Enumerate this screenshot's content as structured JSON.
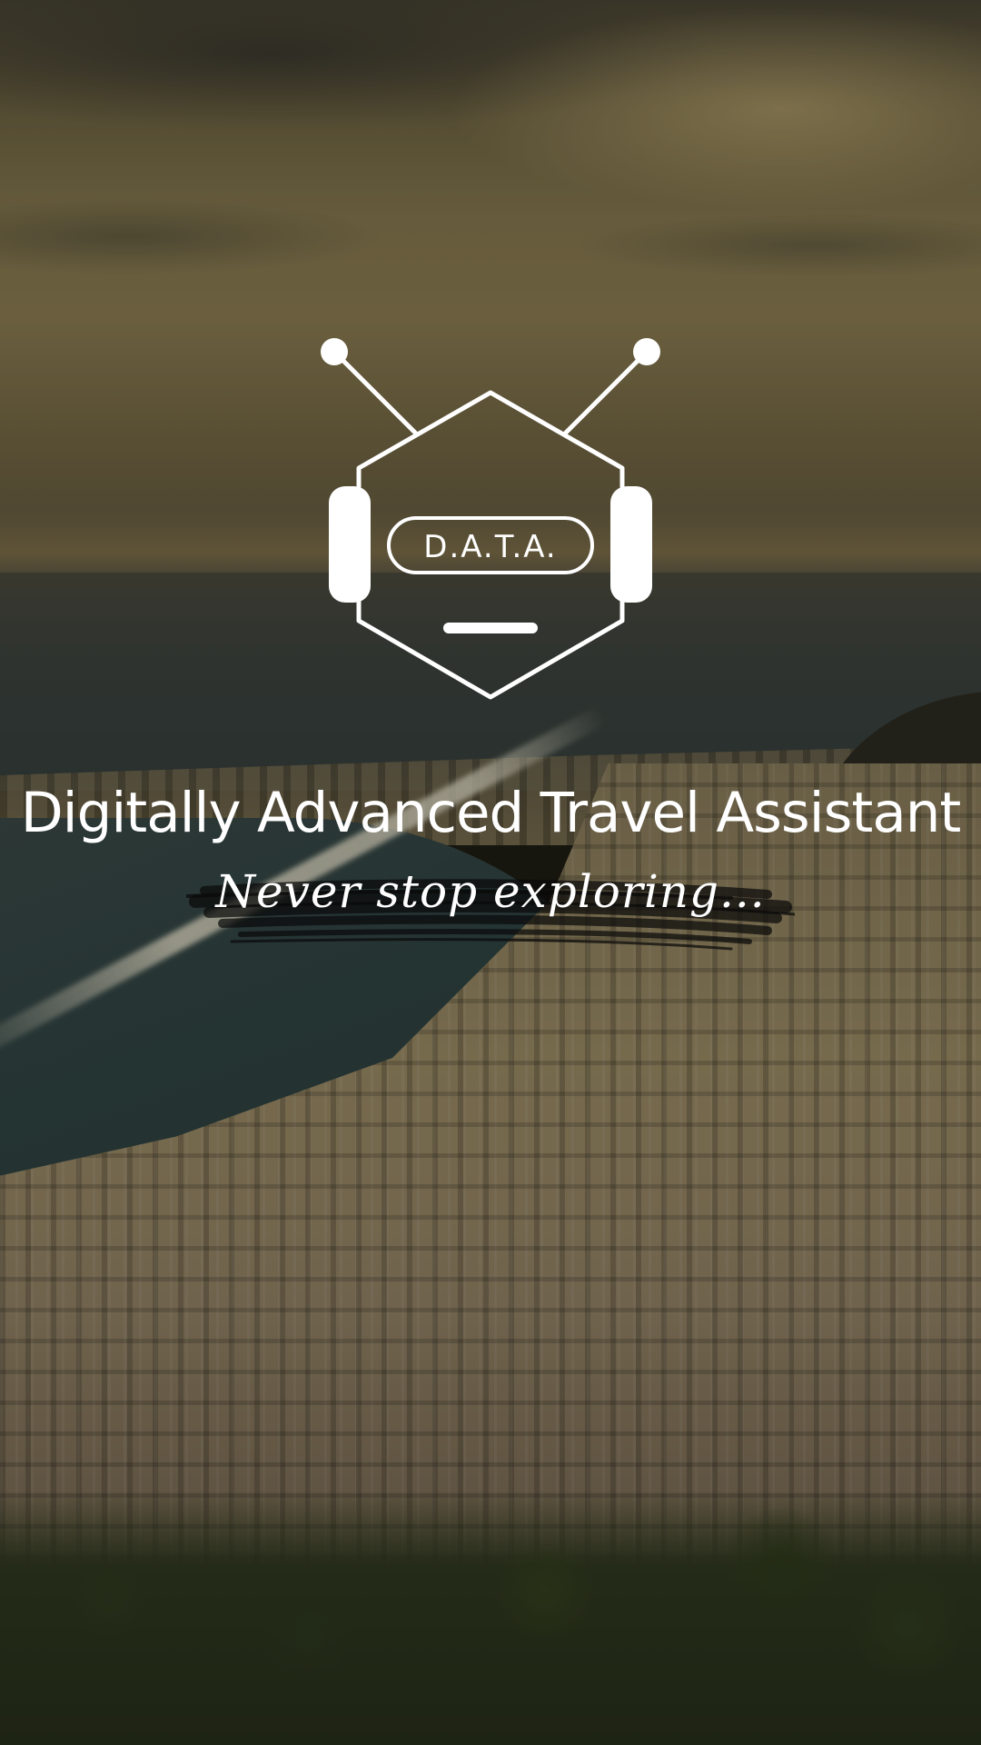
{
  "splash": {
    "logo_text": "D.A.T.A.",
    "title": "Digitally Advanced Travel Assistant",
    "tagline": "Never stop exploring..."
  },
  "theme": {
    "foreground": "#ffffff"
  }
}
